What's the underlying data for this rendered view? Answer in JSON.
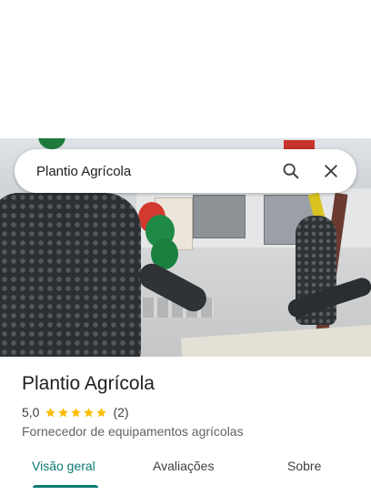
{
  "search": {
    "query": "Plantio Agrícola",
    "search_icon": "search-icon",
    "close_icon": "close-icon"
  },
  "place": {
    "title": "Plantio Agrícola",
    "rating": "5,0",
    "rating_value": 5.0,
    "stars_max": 5,
    "review_count": "(2)",
    "category": "Fornecedor de equipamentos agrícolas"
  },
  "tabs": [
    {
      "label": "Visão geral",
      "active": true
    },
    {
      "label": "Avaliações",
      "active": false
    },
    {
      "label": "Sobre",
      "active": false
    }
  ],
  "colors": {
    "accent": "#0b7a73",
    "star": "#fbbc04"
  }
}
